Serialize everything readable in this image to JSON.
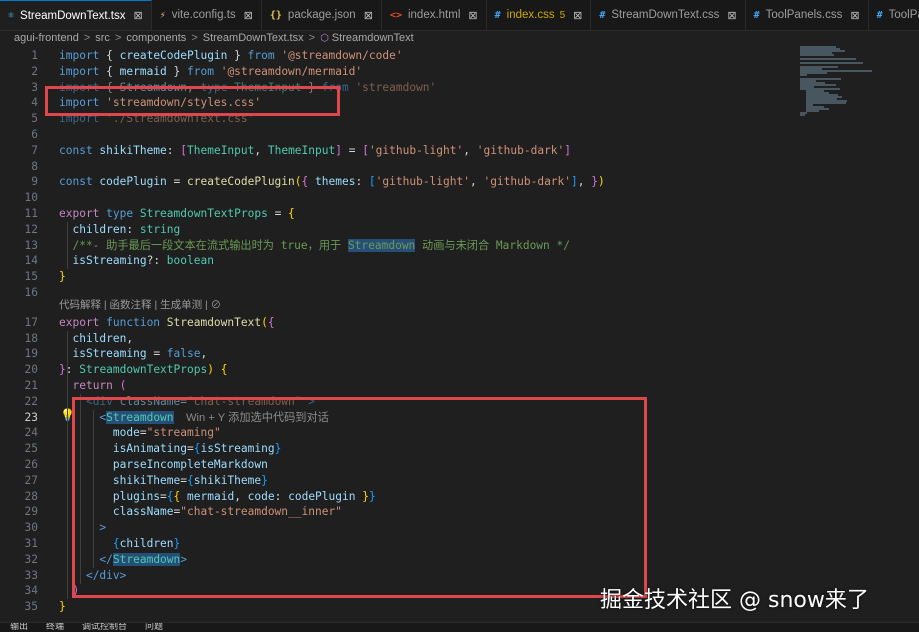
{
  "tabs": [
    {
      "label": "StreamDownText.tsx",
      "icon": "react-icon",
      "glyph": "⚛"
    },
    {
      "label": "vite.config.ts",
      "icon": "vite-icon",
      "glyph": "⚡"
    },
    {
      "label": "package.json",
      "icon": "json-icon",
      "glyph": "{}"
    },
    {
      "label": "index.html",
      "icon": "html-icon",
      "glyph": "<>"
    },
    {
      "label": "index.css",
      "icon": "css-icon",
      "glyph": "#",
      "badge": "5"
    },
    {
      "label": "StreamDownText.css",
      "icon": "css-icon",
      "glyph": "#"
    },
    {
      "label": "ToolPanels.css",
      "icon": "css-icon",
      "glyph": "#"
    },
    {
      "label": "ToolPane",
      "icon": "css-icon",
      "glyph": "#"
    }
  ],
  "close_glyph": "⊠",
  "breadcrumb": [
    "agui-frontend",
    "src",
    "components",
    "StreamDownText.tsx",
    "StreamdownText"
  ],
  "breadcrumb_sep": ">",
  "codelens": "代码解释 | 函数注释 | 生成单测 | ⊘",
  "inline_hint": "Win + Y 添加选中代码到对话",
  "lines": [
    {
      "n": "1",
      "tokens": [
        [
          "k",
          "import "
        ],
        [
          "p",
          "{ "
        ],
        [
          "v",
          "createCodePlugin"
        ],
        [
          "p",
          " } "
        ],
        [
          "k",
          "from "
        ],
        [
          "s",
          "'@streamdown/code'"
        ]
      ]
    },
    {
      "n": "2",
      "tokens": [
        [
          "k",
          "import "
        ],
        [
          "p",
          "{ "
        ],
        [
          "v",
          "mermaid"
        ],
        [
          "p",
          " } "
        ],
        [
          "k",
          "from "
        ],
        [
          "s",
          "'@streamdown/mermaid'"
        ]
      ]
    },
    {
      "n": "3",
      "tokens": [
        [
          "k",
          "import "
        ],
        [
          "p",
          "{ "
        ],
        [
          "v",
          "Streamdown"
        ],
        [
          "p",
          ", "
        ],
        [
          "k",
          "type "
        ],
        [
          "t",
          "ThemeInput"
        ],
        [
          "p",
          " } "
        ],
        [
          "k",
          "from "
        ],
        [
          "s",
          "'streamdown'"
        ]
      ]
    },
    {
      "n": "4",
      "tokens": [
        [
          "k",
          "import "
        ],
        [
          "s",
          "'streamdown/styles.css'"
        ]
      ]
    },
    {
      "n": "5",
      "tokens": [
        [
          "k",
          "import "
        ],
        [
          "s",
          "'./StreamdownText.css'"
        ]
      ]
    },
    {
      "n": "6",
      "tokens": []
    },
    {
      "n": "7",
      "tokens": [
        [
          "k",
          "const "
        ],
        [
          "v",
          "shikiTheme"
        ],
        [
          "p",
          ": "
        ],
        [
          "br2",
          "["
        ],
        [
          "t",
          "ThemeInput"
        ],
        [
          "p",
          ", "
        ],
        [
          "t",
          "ThemeInput"
        ],
        [
          "br2",
          "]"
        ],
        [
          "p",
          " = "
        ],
        [
          "br2",
          "["
        ],
        [
          "s",
          "'github-light'"
        ],
        [
          "p",
          ", "
        ],
        [
          "s",
          "'github-dark'"
        ],
        [
          "br2",
          "]"
        ]
      ]
    },
    {
      "n": "8",
      "tokens": []
    },
    {
      "n": "9",
      "tokens": [
        [
          "k",
          "const "
        ],
        [
          "v",
          "codePlugin"
        ],
        [
          "p",
          " = "
        ],
        [
          "f",
          "createCodePlugin"
        ],
        [
          "br1",
          "("
        ],
        [
          "br2",
          "{ "
        ],
        [
          "v",
          "themes"
        ],
        [
          "p",
          ": "
        ],
        [
          "br3",
          "["
        ],
        [
          "s",
          "'github-light'"
        ],
        [
          "p",
          ", "
        ],
        [
          "s",
          "'github-dark'"
        ],
        [
          "br3",
          "]"
        ],
        [
          "p",
          ", "
        ],
        [
          "br2",
          "}"
        ],
        [
          "br1",
          ")"
        ]
      ]
    },
    {
      "n": "10",
      "tokens": []
    },
    {
      "n": "11",
      "tokens": [
        [
          "kc",
          "export "
        ],
        [
          "k",
          "type "
        ],
        [
          "t",
          "StreamdownTextProps"
        ],
        [
          "p",
          " = "
        ],
        [
          "br1",
          "{"
        ]
      ]
    },
    {
      "n": "12",
      "tokens": [
        [
          "p",
          "  "
        ],
        [
          "v",
          "children"
        ],
        [
          "p",
          ": "
        ],
        [
          "t",
          "string"
        ]
      ]
    },
    {
      "n": "13",
      "tokens": [
        [
          "c",
          "  /**- 助手最后一段文本在流式输出时为 true，用于 "
        ],
        [
          "chl",
          "Streamdown"
        ],
        [
          "c",
          " 动画与未闭合 Markdown */"
        ]
      ]
    },
    {
      "n": "14",
      "tokens": [
        [
          "p",
          "  "
        ],
        [
          "v",
          "isStreaming"
        ],
        [
          "p",
          "?: "
        ],
        [
          "t",
          "boolean"
        ]
      ]
    },
    {
      "n": "15",
      "tokens": [
        [
          "br1",
          "}"
        ]
      ]
    },
    {
      "n": "16",
      "tokens": []
    },
    {
      "n": "17",
      "tokens": [
        [
          "kc",
          "export "
        ],
        [
          "k",
          "function "
        ],
        [
          "f",
          "StreamdownText"
        ],
        [
          "br1",
          "("
        ],
        [
          "br2",
          "{"
        ]
      ]
    },
    {
      "n": "18",
      "tokens": [
        [
          "p",
          "  "
        ],
        [
          "v",
          "children"
        ],
        [
          "p",
          ","
        ]
      ]
    },
    {
      "n": "19",
      "tokens": [
        [
          "p",
          "  "
        ],
        [
          "v",
          "isStreaming"
        ],
        [
          "p",
          " = "
        ],
        [
          "k",
          "false"
        ],
        [
          "p",
          ","
        ]
      ]
    },
    {
      "n": "20",
      "tokens": [
        [
          "br2",
          "}"
        ],
        [
          "p",
          ": "
        ],
        [
          "t",
          "StreamdownTextProps"
        ],
        [
          "br1",
          ")"
        ],
        [
          "p",
          " "
        ],
        [
          "br1",
          "{"
        ]
      ]
    },
    {
      "n": "21",
      "tokens": [
        [
          "p",
          "  "
        ],
        [
          "kc",
          "return "
        ],
        [
          "br2",
          "("
        ]
      ]
    },
    {
      "n": "22",
      "tokens": [
        [
          "p",
          "    "
        ],
        [
          "tg",
          "<div "
        ],
        [
          "ta",
          "className"
        ],
        [
          "p",
          "="
        ],
        [
          "s",
          "\"chat-streamdown\""
        ],
        [
          "tg",
          " >"
        ]
      ]
    },
    {
      "n": "23",
      "tokens": [
        [
          "p",
          "      "
        ],
        [
          "tg",
          "<"
        ],
        [
          "thl",
          "Streamdown"
        ]
      ]
    },
    {
      "n": "24",
      "tokens": [
        [
          "p",
          "        "
        ],
        [
          "ta",
          "mode"
        ],
        [
          "p",
          "="
        ],
        [
          "s",
          "\"streaming\""
        ]
      ]
    },
    {
      "n": "25",
      "tokens": [
        [
          "p",
          "        "
        ],
        [
          "ta",
          "isAnimating"
        ],
        [
          "p",
          "="
        ],
        [
          "br3",
          "{"
        ],
        [
          "v",
          "isStreaming"
        ],
        [
          "br3",
          "}"
        ]
      ]
    },
    {
      "n": "26",
      "tokens": [
        [
          "p",
          "        "
        ],
        [
          "ta",
          "parseIncompleteMarkdown"
        ]
      ]
    },
    {
      "n": "27",
      "tokens": [
        [
          "p",
          "        "
        ],
        [
          "ta",
          "shikiTheme"
        ],
        [
          "p",
          "="
        ],
        [
          "br3",
          "{"
        ],
        [
          "v",
          "shikiTheme"
        ],
        [
          "br3",
          "}"
        ]
      ]
    },
    {
      "n": "28",
      "tokens": [
        [
          "p",
          "        "
        ],
        [
          "ta",
          "plugins"
        ],
        [
          "p",
          "="
        ],
        [
          "br3",
          "{"
        ],
        [
          "br1",
          "{ "
        ],
        [
          "v",
          "mermaid"
        ],
        [
          "p",
          ", "
        ],
        [
          "v",
          "code"
        ],
        [
          "p",
          ": "
        ],
        [
          "v",
          "codePlugin"
        ],
        [
          "br1",
          " }"
        ],
        [
          "br3",
          "}"
        ]
      ]
    },
    {
      "n": "29",
      "tokens": [
        [
          "p",
          "        "
        ],
        [
          "ta",
          "className"
        ],
        [
          "p",
          "="
        ],
        [
          "s",
          "\"chat-streamdown__inner\""
        ]
      ]
    },
    {
      "n": "30",
      "tokens": [
        [
          "p",
          "      "
        ],
        [
          "tg",
          ">"
        ]
      ]
    },
    {
      "n": "31",
      "tokens": [
        [
          "p",
          "        "
        ],
        [
          "br3",
          "{"
        ],
        [
          "v",
          "children"
        ],
        [
          "br3",
          "}"
        ]
      ]
    },
    {
      "n": "32",
      "tokens": [
        [
          "p",
          "      "
        ],
        [
          "tg",
          "</"
        ],
        [
          "thl",
          "Streamdown"
        ],
        [
          "tg",
          ">"
        ]
      ]
    },
    {
      "n": "33",
      "tokens": [
        [
          "p",
          "    "
        ],
        [
          "tg",
          "</div>"
        ]
      ]
    },
    {
      "n": "34",
      "tokens": [
        [
          "p",
          "  "
        ],
        [
          "br2",
          ")"
        ]
      ]
    },
    {
      "n": "35",
      "tokens": [
        [
          "br1",
          "}"
        ]
      ]
    }
  ],
  "watermark": "掘金技术社区 @ snow来了",
  "bottom_panel": [
    "输出",
    "终端",
    "调试控制台",
    "问题"
  ],
  "colors": {
    "accent": "#0078d4",
    "highlight_box": "#e0474c"
  }
}
